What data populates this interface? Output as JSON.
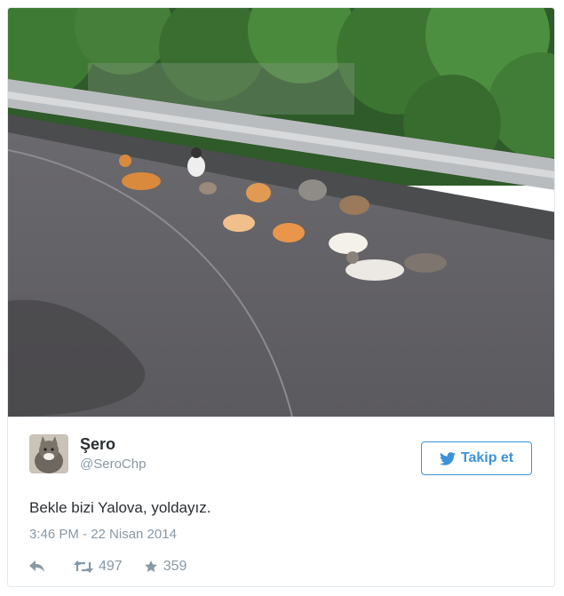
{
  "tweet": {
    "display_name": "Şero",
    "username": "@SeroChp",
    "text": "Bekle bizi Yalova, yoldayız.",
    "timestamp": "3:46 PM - 22 Nisan 2014",
    "retweet_count": "497",
    "favorite_count": "359"
  },
  "follow_button": {
    "label": "Takip et"
  },
  "photo": {
    "subject": "cats-sitting-on-road"
  },
  "icons": {
    "follow": "twitter-bird-icon",
    "reply": "reply-icon",
    "retweet": "retweet-icon",
    "favorite": "star-icon"
  },
  "colors": {
    "accent": "#3b94d9",
    "muted": "#8899a6",
    "text": "#292f33",
    "border": "#e1e8ed"
  }
}
